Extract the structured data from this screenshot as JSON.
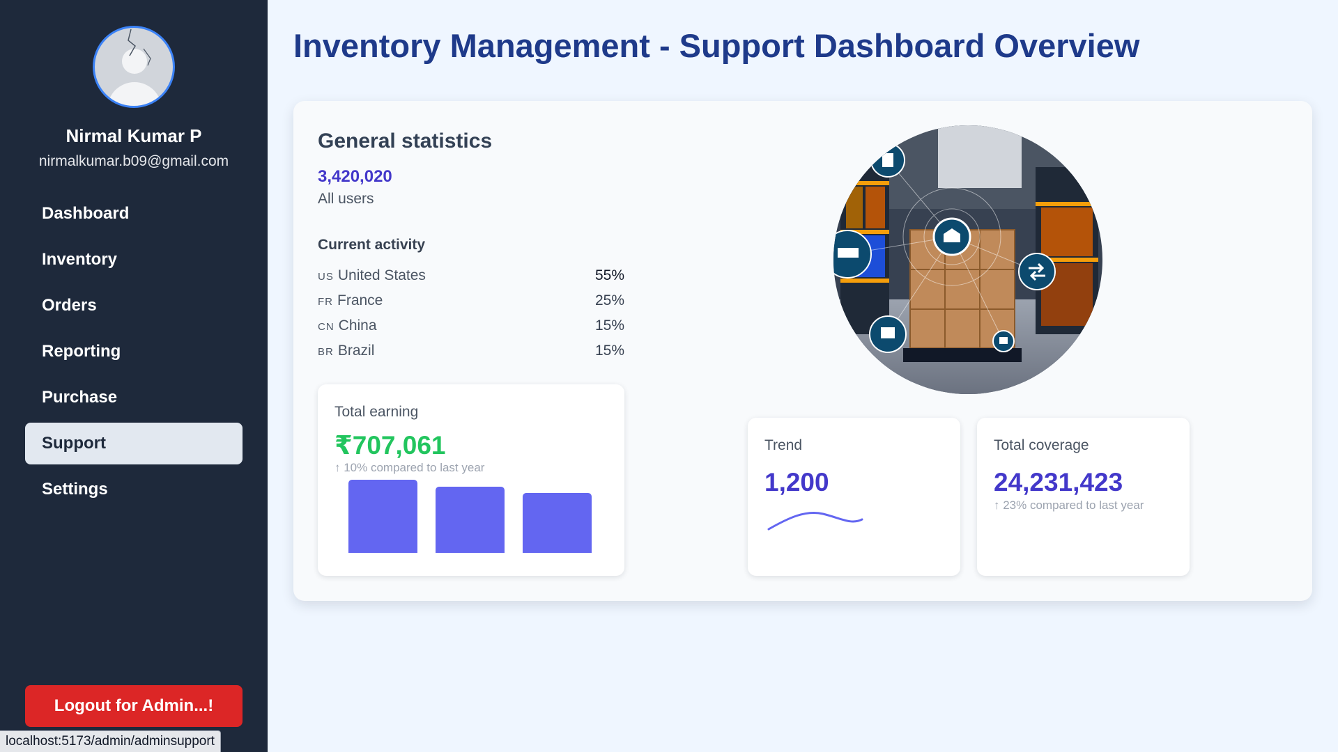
{
  "user": {
    "name": "Nirmal Kumar P",
    "email": "nirmalkumar.b09@gmail.com"
  },
  "nav": [
    {
      "label": "Dashboard",
      "active": false
    },
    {
      "label": "Inventory",
      "active": false
    },
    {
      "label": "Orders",
      "active": false
    },
    {
      "label": "Reporting",
      "active": false
    },
    {
      "label": "Purchase",
      "active": false
    },
    {
      "label": "Support",
      "active": true
    },
    {
      "label": "Settings",
      "active": false
    }
  ],
  "logout_label": "Logout for Admin...!",
  "status_url": "localhost:5173/admin/adminsupport",
  "page_title": "Inventory Management - Support Dashboard Overview",
  "general": {
    "title": "General statistics",
    "users_value": "3,420,020",
    "users_label": "All users",
    "activity_title": "Current activity",
    "activity": [
      {
        "code": "US",
        "country": "United States",
        "pct": "55%"
      },
      {
        "code": "FR",
        "country": "France",
        "pct": "25%"
      },
      {
        "code": "CN",
        "country": "China",
        "pct": "15%"
      },
      {
        "code": "BR",
        "country": "Brazil",
        "pct": "15%"
      }
    ]
  },
  "earning": {
    "label": "Total earning",
    "value": "₹707,061",
    "sub": "↑ 10% compared to last year",
    "bars": [
      100,
      90,
      82
    ],
    "bar_color": "#6366f1"
  },
  "trend": {
    "label": "Trend",
    "value": "1,200",
    "line_color": "#6366f1"
  },
  "coverage": {
    "label": "Total coverage",
    "value": "24,231,423",
    "sub": "↑ 23% compared to last year"
  },
  "colors": {
    "sidebar": "#1e293b",
    "accent": "#4338ca",
    "positive": "#22c55e",
    "logout": "#dc2626",
    "title": "#1e3a8a"
  },
  "hero_icons": [
    "document-icon",
    "pallets-icon",
    "warehouse-icon",
    "transfer-arrows-icon",
    "handling-icon",
    "forklift-icon"
  ]
}
